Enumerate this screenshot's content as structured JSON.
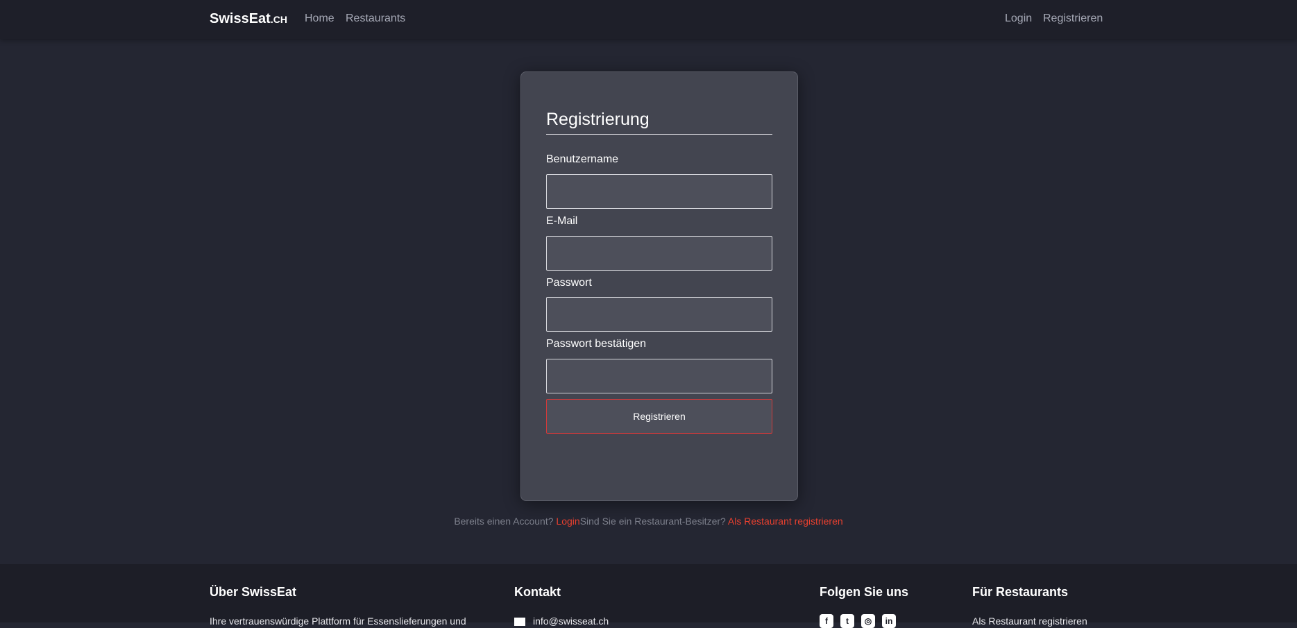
{
  "navbar": {
    "brand_main": "SwissEat",
    "brand_tld": ".CH",
    "home": "Home",
    "restaurants": "Restaurants",
    "login": "Login",
    "register": "Registrieren"
  },
  "form": {
    "title": "Registrierung",
    "username_label": "Benutzername",
    "email_label": "E-Mail",
    "password_label": "Passwort",
    "password_confirm_label": "Passwort bestätigen",
    "username_value": "",
    "email_value": "",
    "password_value": "",
    "password_confirm_value": "",
    "submit_label": "Registrieren"
  },
  "below": {
    "account_text": "Bereits einen Account?",
    "login_link": "Login",
    "owner_text": "Sind Sie ein Restaurant-Besitzer?",
    "restaurant_link": "Als Restaurant registrieren"
  },
  "footer": {
    "about_title": "Über SwissEat",
    "about_text": "Ihre vertrauenswürdige Plattform für Essenslieferungen und",
    "contact_title": "Kontakt",
    "contact_email": "info@swisseat.ch",
    "follow_title": "Folgen Sie uns",
    "social_icons": [
      "facebook-icon",
      "twitter-icon",
      "instagram-icon",
      "linkedin-icon"
    ],
    "restaurants_title": "Für Restaurants",
    "restaurants_link": "Als Restaurant registrieren"
  },
  "colors": {
    "background": "#242632",
    "navbar": "#1e1f29",
    "card": "#434550",
    "accent_red": "#e8402f"
  }
}
